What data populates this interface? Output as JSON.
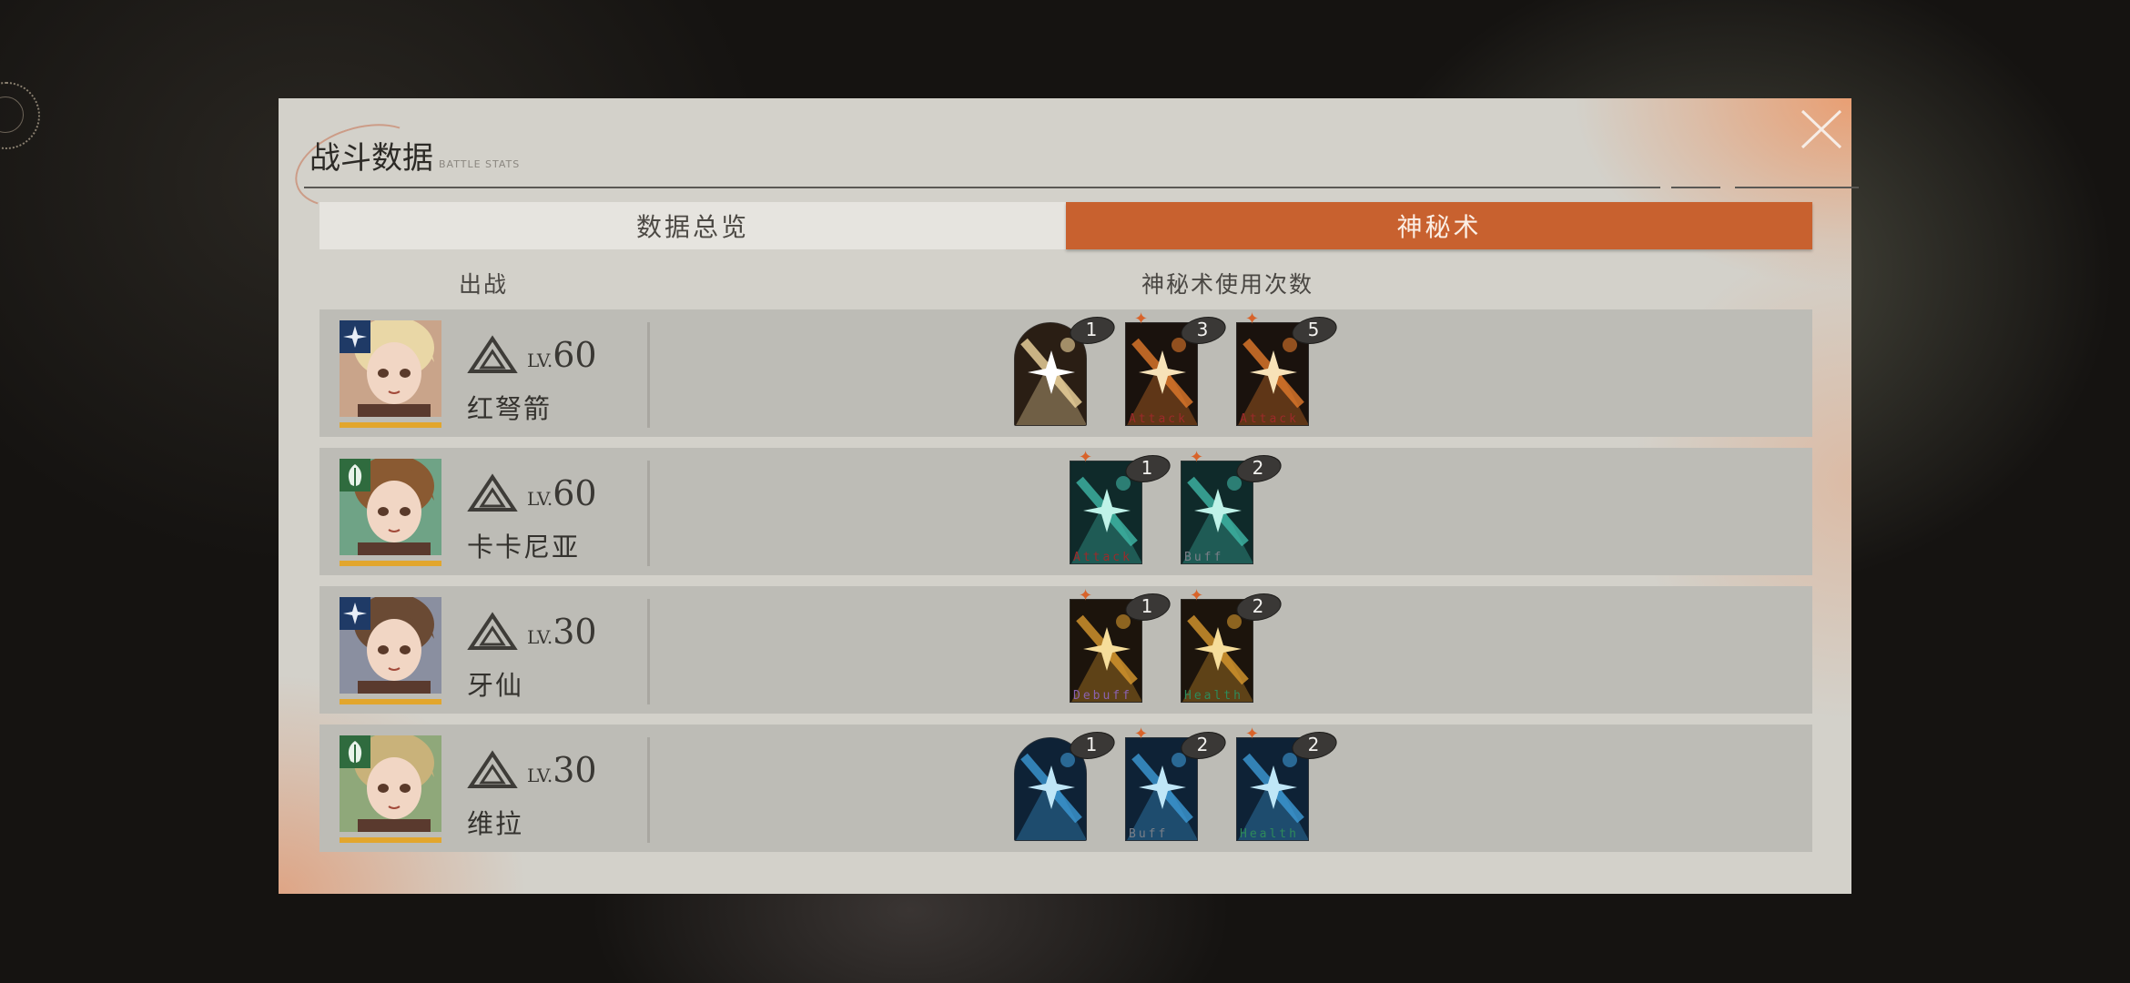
{
  "title": {
    "cn": "战斗数据",
    "en": "BATTLE STATS"
  },
  "tabs": [
    {
      "label": "数据总览",
      "active": false
    },
    {
      "label": "神秘术",
      "active": true
    }
  ],
  "columns": {
    "deploy": "出战",
    "arcane_usage": "神秘术使用次数"
  },
  "lv_prefix": "LV.",
  "colors": {
    "accent": "#c8612f",
    "panel": "#d3d1ca",
    "row": "#bdbcb6",
    "level_bar": "#e2a62d"
  },
  "rows": [
    {
      "name": "红弩箭",
      "level": "60",
      "afflatus": "star",
      "badge_color": "#1f3a66",
      "cards": [
        {
          "type": "ultimate",
          "count": "1",
          "label": "",
          "theme": "gold"
        },
        {
          "type": "attack",
          "count": "3",
          "label": "Attack",
          "theme": "orange"
        },
        {
          "type": "attack",
          "count": "5",
          "label": "Attack",
          "theme": "orange"
        }
      ]
    },
    {
      "name": "卡卡尼亚",
      "level": "60",
      "afflatus": "plant",
      "badge_color": "#2f6b3e",
      "cards": [
        {
          "type": "attack",
          "count": "1",
          "label": "Attack",
          "theme": "teal"
        },
        {
          "type": "buff",
          "count": "2",
          "label": "Buff",
          "theme": "teal"
        }
      ]
    },
    {
      "name": "牙仙",
      "level": "30",
      "afflatus": "star",
      "badge_color": "#1f3a66",
      "cards": [
        {
          "type": "debuff",
          "count": "1",
          "label": "Debuff",
          "theme": "amber"
        },
        {
          "type": "health",
          "count": "2",
          "label": "Health",
          "theme": "amber"
        }
      ]
    },
    {
      "name": "维拉",
      "level": "30",
      "afflatus": "plant",
      "badge_color": "#2f6b3e",
      "cards": [
        {
          "type": "ultimate",
          "count": "1",
          "label": "",
          "theme": "blue"
        },
        {
          "type": "buff",
          "count": "2",
          "label": "Buff",
          "theme": "blue"
        },
        {
          "type": "health",
          "count": "2",
          "label": "Health",
          "theme": "blue"
        }
      ]
    }
  ]
}
